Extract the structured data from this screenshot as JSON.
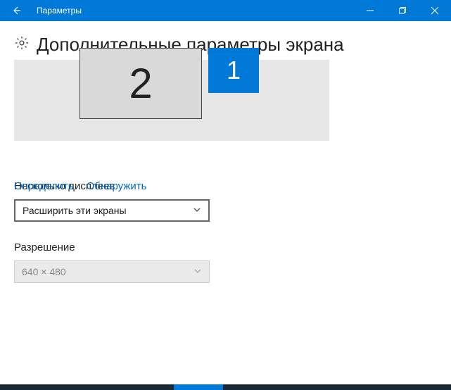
{
  "titlebar": {
    "title": "Параметры"
  },
  "page": {
    "heading": "Дополнительные параметры экрана"
  },
  "displays": {
    "monitor1_label": "1",
    "monitor2_label": "2"
  },
  "links": {
    "identify": "Определить",
    "detect": "Обнаружить"
  },
  "multiple_displays": {
    "label": "Несколько дисплеев",
    "value": "Расширить эти экраны"
  },
  "resolution": {
    "label": "Разрешение",
    "value": "640 × 480"
  }
}
